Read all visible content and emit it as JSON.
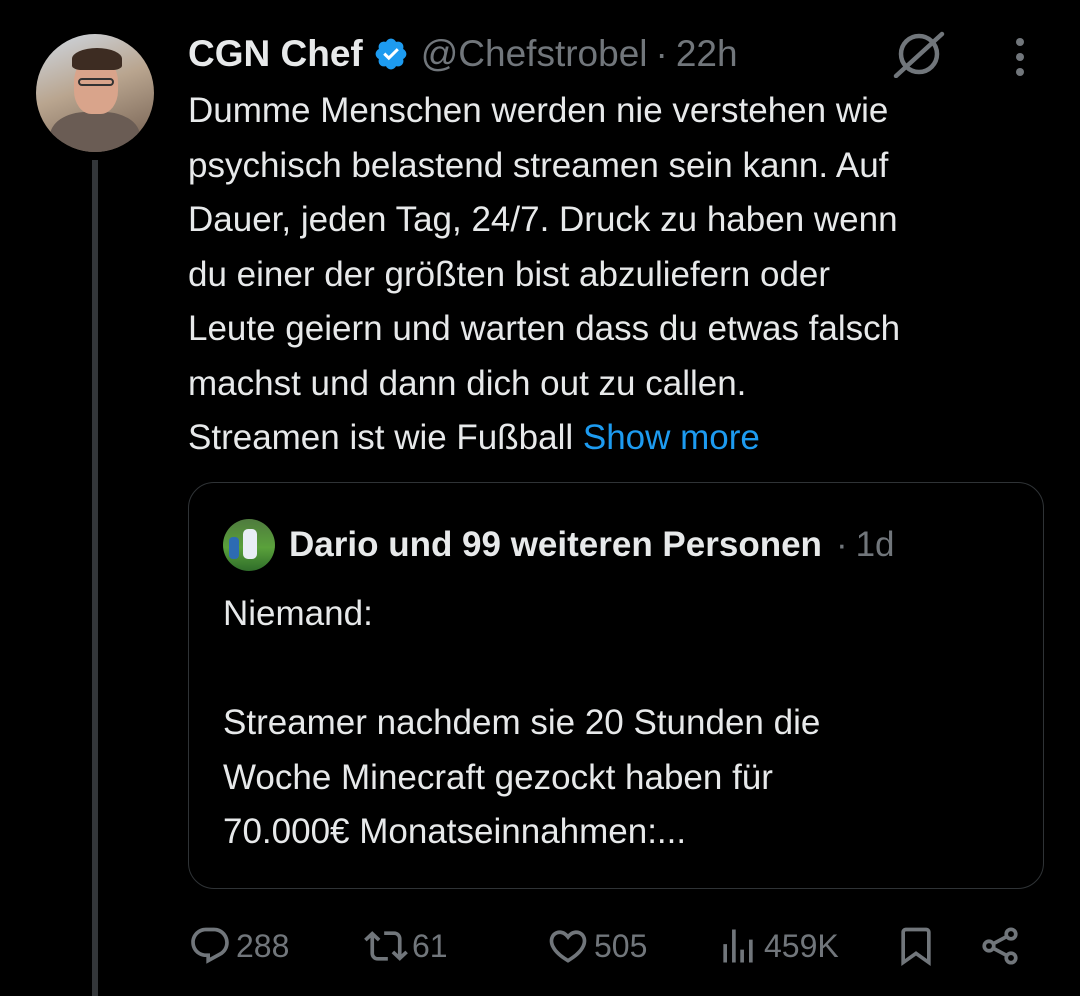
{
  "tweet": {
    "author_name": "CGN Chef",
    "handle": "@Chefstrobel",
    "separator": "·",
    "time": "22h",
    "text_lines": [
      "Dumme Menschen werden nie verstehen wie",
      "psychisch belastend streamen sein kann. Auf",
      "Dauer, jeden Tag, 24/7. Druck zu haben wenn",
      "du einer der größten bist abzuliefern oder",
      "Leute geiern und warten dass du etwas falsch",
      "machst und dann dich out zu callen.",
      "Streamen ist wie Fußball"
    ],
    "show_more": "Show more"
  },
  "quote": {
    "author_name": "Dario und 99 weiteren Personen",
    "separator": "·",
    "time": "1d",
    "text_lines": [
      "Niemand:",
      "",
      "Streamer nachdem sie 20 Stunden die",
      "Woche Minecraft gezockt haben für",
      "70.000€ Monatseinnahmen:..."
    ]
  },
  "actions": {
    "replies": "288",
    "reposts": "61",
    "likes": "505",
    "views": "459K"
  },
  "icons": {
    "verified": "verified-badge-icon",
    "grok": "grok-icon",
    "more": "more-vertical-icon",
    "reply": "reply-icon",
    "repost": "repost-icon",
    "like": "heart-icon",
    "views": "views-icon",
    "bookmark": "bookmark-icon",
    "share": "share-icon"
  },
  "colors": {
    "background": "#000000",
    "text": "#e7e9ea",
    "muted": "#71767b",
    "link": "#1d9bf0",
    "verified": "#1d9bf0",
    "border": "#2f3336"
  }
}
